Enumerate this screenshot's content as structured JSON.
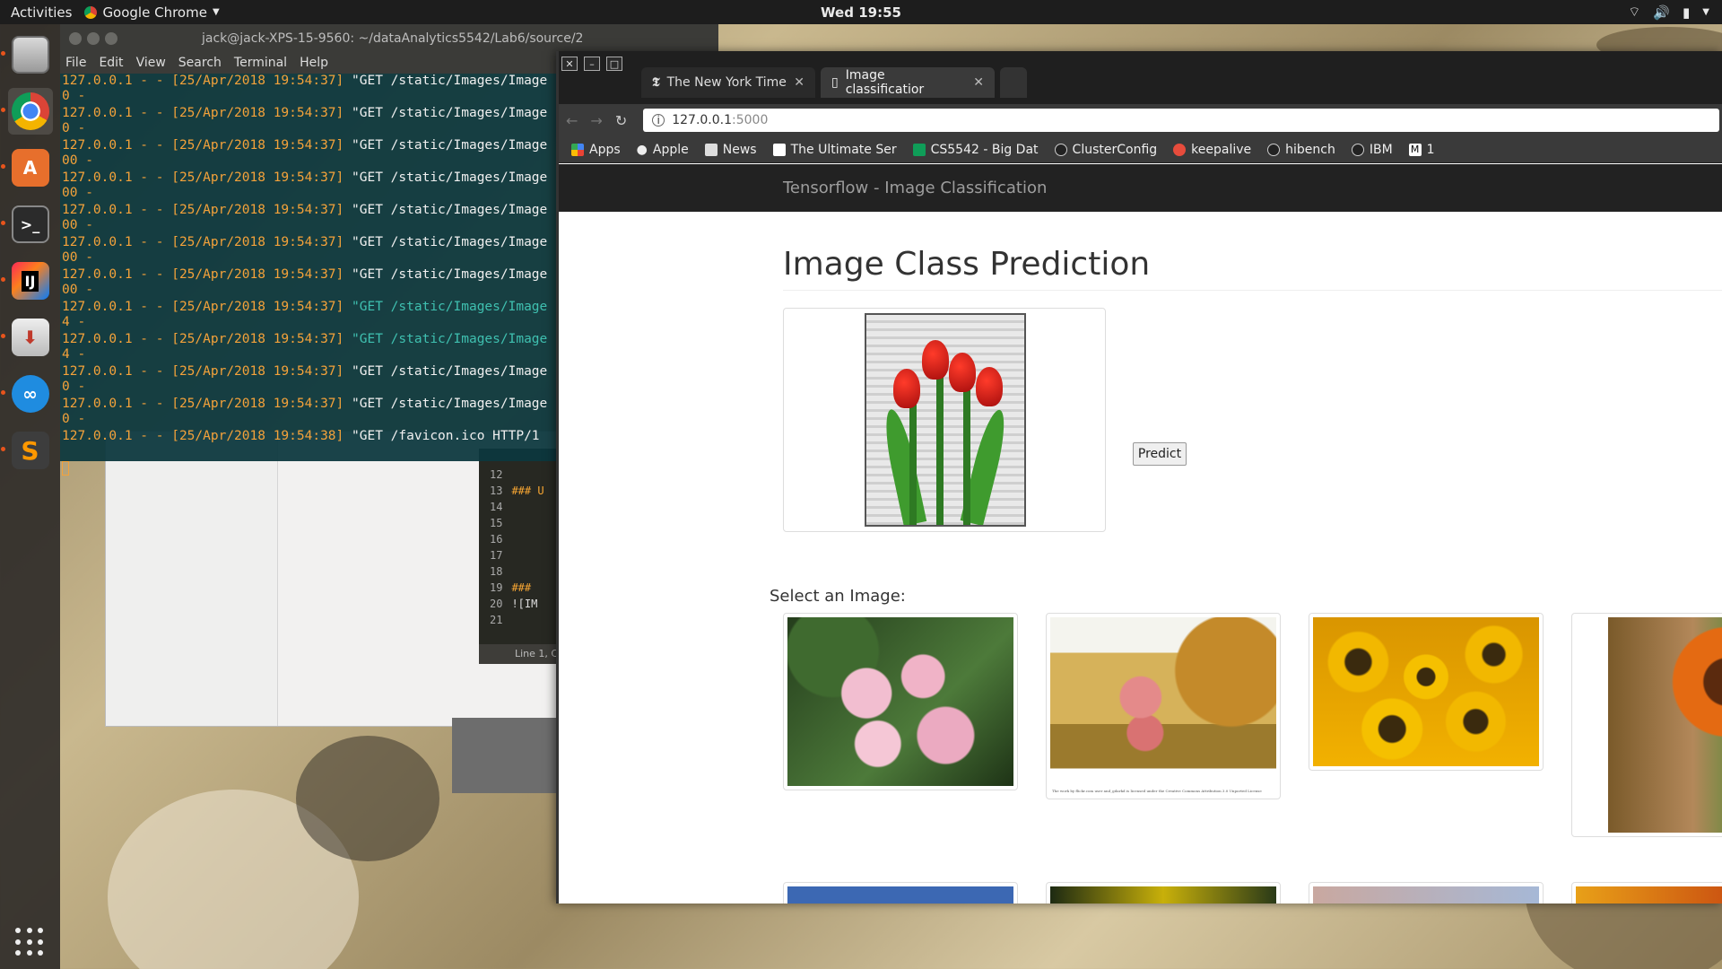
{
  "topbar": {
    "activities": "Activities",
    "app_name": "Google Chrome",
    "clock": "Wed 19:55"
  },
  "terminal": {
    "title": "jack@jack-XPS-15-9560: ~/dataAnalytics5542/Lab6/source/2",
    "menu": [
      "File",
      "Edit",
      "View",
      "Search",
      "Terminal",
      "Help"
    ],
    "lines": [
      {
        "ip": "127.0.0.1 - - [25/Apr/2018 19:54:37] ",
        "req": "\"GET /static/Images/Image",
        "cont": "0 -",
        "teal": false
      },
      {
        "ip": "127.0.0.1 - - [25/Apr/2018 19:54:37] ",
        "req": "\"GET /static/Images/Image",
        "cont": "0 -",
        "teal": false
      },
      {
        "ip": "127.0.0.1 - - [25/Apr/2018 19:54:37] ",
        "req": "\"GET /static/Images/Image",
        "cont": "00 -",
        "teal": false
      },
      {
        "ip": "127.0.0.1 - - [25/Apr/2018 19:54:37] ",
        "req": "\"GET /static/Images/Image",
        "cont": "00 -",
        "teal": false
      },
      {
        "ip": "127.0.0.1 - - [25/Apr/2018 19:54:37] ",
        "req": "\"GET /static/Images/Image",
        "cont": "00 -",
        "teal": false
      },
      {
        "ip": "127.0.0.1 - - [25/Apr/2018 19:54:37] ",
        "req": "\"GET /static/Images/Image",
        "cont": "00 -",
        "teal": false
      },
      {
        "ip": "127.0.0.1 - - [25/Apr/2018 19:54:37] ",
        "req": "\"GET /static/Images/Image",
        "cont": "00 -",
        "teal": false
      },
      {
        "ip": "127.0.0.1 - - [25/Apr/2018 19:54:37] ",
        "req": "\"GET /static/Images/Image",
        "cont": "4 -",
        "teal": true
      },
      {
        "ip": "127.0.0.1 - - [25/Apr/2018 19:54:37] ",
        "req": "\"GET /static/Images/Image",
        "cont": "4 -",
        "teal": true
      },
      {
        "ip": "127.0.0.1 - - [25/Apr/2018 19:54:37] ",
        "req": "\"GET /static/Images/Image",
        "cont": "0 -",
        "teal": false
      },
      {
        "ip": "127.0.0.1 - - [25/Apr/2018 19:54:37] ",
        "req": "\"GET /static/Images/Image",
        "cont": "0 -",
        "teal": false
      },
      {
        "ip": "127.0.0.1 - - [25/Apr/2018 19:54:38] ",
        "req": "\"GET /favicon.ico HTTP/1",
        "cont": "",
        "teal": false
      }
    ]
  },
  "sublime": {
    "line_numbers": [
      "12",
      "13",
      "14",
      "15",
      "16",
      "17",
      "18",
      "19",
      "20",
      "21"
    ],
    "snippets": {
      "13": "### U",
      "19": "###",
      "20": "![IM"
    },
    "status": "Line 1, C"
  },
  "chrome": {
    "tabs": [
      {
        "label": "The New York Time",
        "active": false
      },
      {
        "label": "Image classificatior",
        "active": true
      }
    ],
    "url_host": "127.0.0.1",
    "url_port": ":5000",
    "bookmarks": [
      "Apps",
      "Apple",
      "News",
      "The Ultimate Ser",
      "CS5542 - Big Dat",
      "ClusterConfig",
      "keepalive",
      "hibench",
      "IBM",
      "1"
    ]
  },
  "page": {
    "brand": "Tensorflow - Image Classification",
    "title": "Image Class Prediction",
    "predict_label": "Predict",
    "select_label": "Select an Image:",
    "caption": "The work by flickr.com user and_gdarkd is licensed under the Creative Commons Attribution 3.0 Unported License"
  },
  "colors": {
    "navbar_bg": "#222222",
    "terminal_text": "#f4a23a",
    "terminal_bg": "#0c373e"
  }
}
